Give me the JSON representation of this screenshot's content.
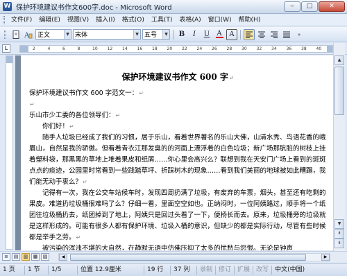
{
  "window": {
    "title": "保护环境建议书作文600字.doc - Microsoft Word",
    "app_icon": "W",
    "minimize": "‒",
    "maximize": "□",
    "close": "✕"
  },
  "menu": {
    "items": [
      "文件(F)",
      "编辑(E)",
      "视图(V)",
      "插入(I)",
      "格式(O)",
      "工具(T)",
      "表格(A)",
      "窗口(W)",
      "帮助(H)"
    ]
  },
  "toolbar": {
    "style": "正文",
    "font": "宋体",
    "size": "五号",
    "bold": "B",
    "italic": "I",
    "underline": "U",
    "font_color": "A",
    "char_border": "A",
    "icons": [
      "new-doc-icon",
      "styles-pane-icon",
      "align-left-icon",
      "align-center-icon",
      "align-right-icon",
      "justify-icon"
    ]
  },
  "ruler": {
    "corner": "L",
    "ticks": [
      "2",
      "4",
      "6",
      "8",
      "10",
      "12",
      "14",
      "16",
      "18",
      "20",
      "22",
      "24",
      "26",
      "28",
      "30",
      "32",
      "34",
      "36",
      "38",
      "40"
    ]
  },
  "document": {
    "title": "保护环境建议书作文 600 字",
    "paragraphs": [
      "保护环境建议书作文 600 字范文一：",
      "",
      "乐山市少工委的各位领导们：",
      "你们好！",
      "随手人垃圾已经成了我们的习惯，居于乐山，看着世界著名的乐山大佛，山清水秀、鸟语花香的峨眉山，自然是我的骄傲。但看着青衣江那发臭的的河面上漂浮着的白色垃圾；新广场那肮脏的树枝上挂着塑料袋，那黑黑的草地上堆着果皮和纸屑……你心里会高兴么？联想到我在天安门广场上看到的斑斑点点的痰迹，公园里时常看到一些践踏草坪、折踩树木的现象……看到我们美丽的地球被如此糟蹋，我们能无动于衷么？",
      "记得有一次，我在公交车站候车时，发现四周扔满了垃圾，有废弃的车票，烟头，甚至还有吃剩的果皮。难道扔垃圾桶很难吗了么？仔细一看，里面空空如也。正纳闷时，一位阿姨路过，顺手将一个纸团往垃圾桶扔去，纸团掉到了地上，阿姨只是回过头看了一下，便扬长而去。原来，垃圾桶旁的垃圾就是这样形成的。可能有很多人都有保护环境、垃圾入桶的意识，但缺少的都是实际行动，尽管有些时候都是举手之劳。",
      "被污染的浑浊不堪的大自然，在静默无语中仿佛压抑了太多的忧愁与怨恨。无论是钟声"
    ],
    "para_mark": "↵"
  },
  "scrollbar": {
    "up": "▲",
    "down": "▼",
    "left": "◀",
    "right": "▶"
  },
  "views": [
    "≡",
    "▤",
    "▥",
    "▦",
    "▧"
  ],
  "status": {
    "page": "1 页",
    "section": "1 节",
    "pages": "1/5",
    "position": "位置 12.9厘米",
    "line": "19 行",
    "column": "37 列",
    "rec": "录制",
    "trk": "修订",
    "ext": "扩展",
    "ovr": "改写",
    "language": "中文(中国)"
  }
}
